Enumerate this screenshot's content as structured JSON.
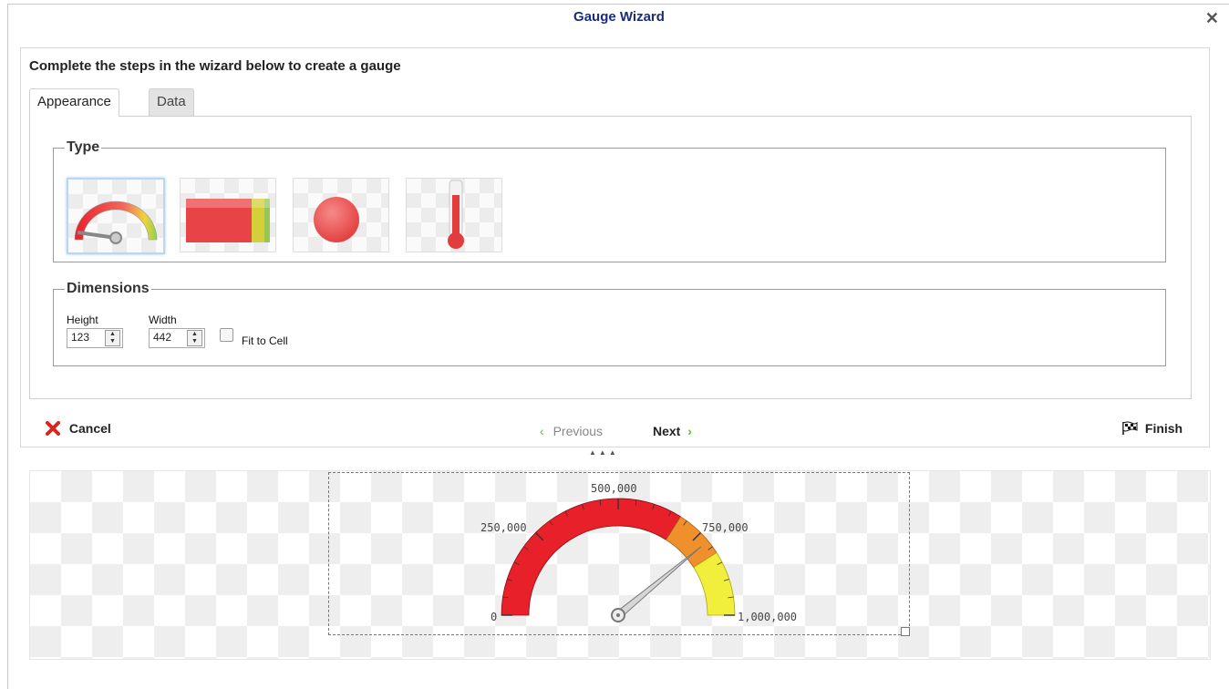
{
  "dialog": {
    "title": "Gauge Wizard",
    "close_glyph": "✕"
  },
  "intro": "Complete the steps in the wizard below to create a gauge",
  "tabs": [
    {
      "label": "Appearance",
      "active": true
    },
    {
      "label": "Data",
      "active": false
    }
  ],
  "type_section": {
    "legend": "Type",
    "options": [
      {
        "icon": "radial-gauge-icon",
        "selected": true
      },
      {
        "icon": "bar-gauge-icon",
        "selected": false
      },
      {
        "icon": "bulb-gauge-icon",
        "selected": false
      },
      {
        "icon": "thermometer-gauge-icon",
        "selected": false
      }
    ]
  },
  "dimensions": {
    "legend": "Dimensions",
    "height_label": "Height",
    "height_value": "123",
    "width_label": "Width",
    "width_value": "442",
    "fit_label": "Fit to Cell",
    "fit_checked": false
  },
  "footer": {
    "cancel": "Cancel",
    "previous": "Previous",
    "next": "Next",
    "finish": "Finish"
  },
  "preview_gauge": {
    "labels": {
      "min": "0",
      "q1": "250,000",
      "mid": "500,000",
      "q3": "750,000",
      "max": "1,000,000"
    },
    "colors": {
      "red": "#e8202a",
      "orange": "#f0902c",
      "yellow": "#f2ee3c"
    }
  }
}
